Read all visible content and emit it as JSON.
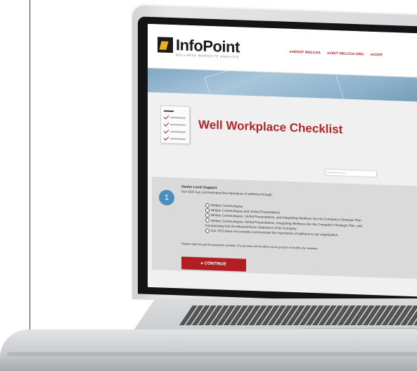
{
  "header": {
    "logo_text": "InfoPoint",
    "logo_subtitle": "WELLNESS WORKSITE ANALYSIS",
    "nav": [
      "ABOUT WELCOA",
      "VISIT WELCOA.ORG",
      "CONT"
    ]
  },
  "main": {
    "title": "Well Workplace Checklist",
    "search_placeholder": "Search wellcoa.org"
  },
  "question": {
    "number": "1",
    "heading": "Senior Level Support",
    "text": "Our CEO has communicated the importance of wellness through:",
    "options": [
      "Written Communiques",
      "Written Communiques and Verbal Presentations",
      "Written Communiques, Verbal Presentations, and Integrating Wellness into the Company's Strategic Plan",
      "Written Communiques, Verbal Presentations, Integrating Wellness into the Company's Strategic Plan, and Incorporating into the Mission/Vision Statement of the Company",
      "Our CEO does not currently communicate the importance of wellness to our organization."
    ]
  },
  "actions": {
    "continue_label": "CONTINUE"
  },
  "footnote": "Please read through the questions carefully. The process will not allow you to go back to modify your answers.",
  "colors": {
    "accent": "#b3262a",
    "button": "#b11f23",
    "badge": "#4c8fbf"
  }
}
